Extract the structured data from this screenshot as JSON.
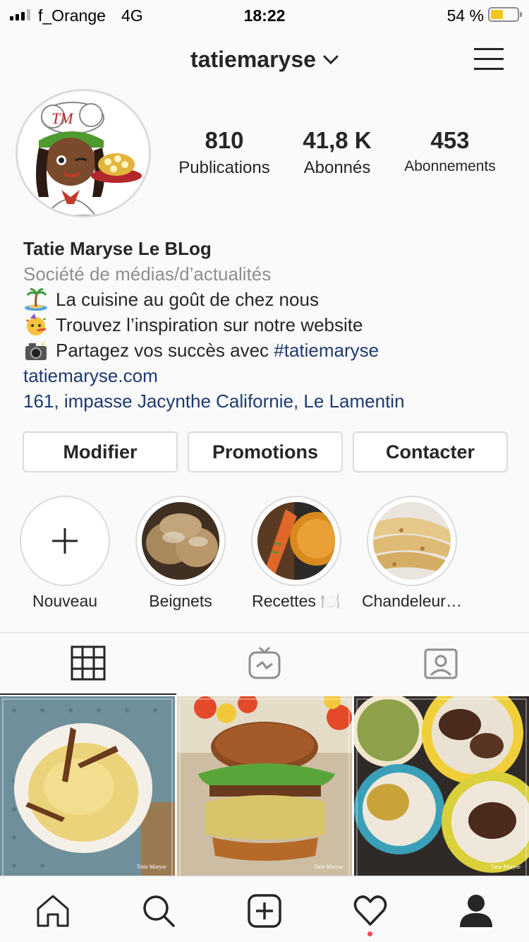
{
  "status_bar": {
    "carrier": "f_Orange",
    "network": "4G",
    "time": "18:22",
    "battery": "54 %"
  },
  "header": {
    "username": "tatiemaryse"
  },
  "stats": {
    "posts_count": "810",
    "posts_label": "Publications",
    "followers_count": "41,8 K",
    "followers_label": "Abonnés",
    "following_count": "453",
    "following_label": "Abonnements"
  },
  "bio": {
    "name": "Tatie Maryse Le BLog",
    "category": "Société de médias/d’actualités",
    "line1": "La cuisine au goût de chez nous",
    "line2": "Trouvez l’inspiration sur notre website",
    "line3_prefix": "Partagez vos succès avec ",
    "line3_hashtag": "#tatiemaryse",
    "website": "tatiemaryse.com",
    "address": "161, impasse Jacynthe Californie, Le Lamentin"
  },
  "buttons": {
    "edit": "Modifier",
    "promotions": "Promotions",
    "contact": "Contacter"
  },
  "highlights": [
    {
      "label": "Nouveau"
    },
    {
      "label": "Beignets"
    },
    {
      "label": "Recettes 🍽️"
    },
    {
      "label": "Chandeleur…"
    }
  ],
  "avatar_text": "TM",
  "watermark": "Tatie Maryse",
  "colors": {
    "link": "#1f3a6e",
    "muted": "#8e8e8e",
    "border": "#dbdbdb",
    "notification": "#ed4956",
    "battery": "#f5c51f"
  }
}
